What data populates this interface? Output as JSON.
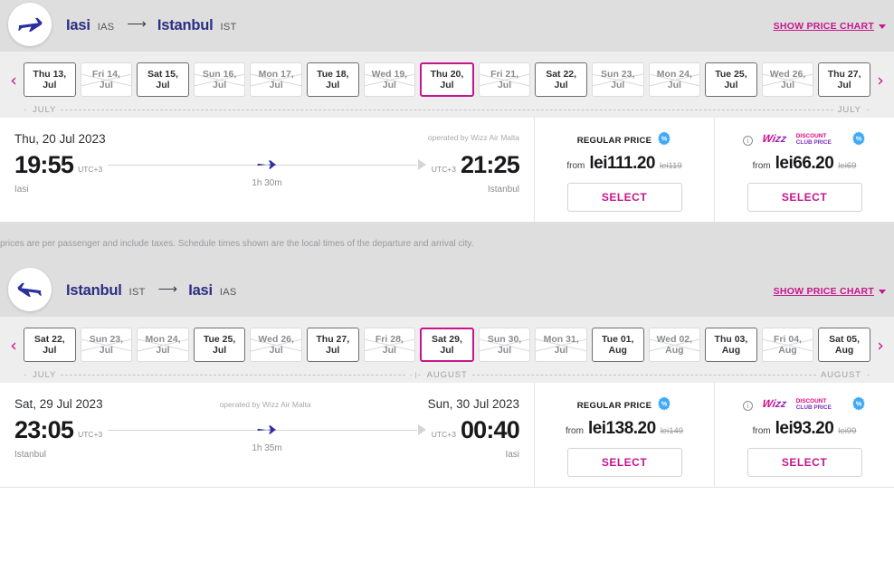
{
  "journeys": [
    {
      "icon": "plane-right-icon",
      "origin_city": "Iasi",
      "origin_code": "IAS",
      "arrow": "⟶",
      "dest_city": "Istanbul",
      "dest_code": "IST",
      "price_chart_label": "SHOW PRICE CHART",
      "dates": [
        {
          "day": "Thu 13,",
          "month": "Jul",
          "state": "avail"
        },
        {
          "day": "Fri 14,",
          "month": "Jul",
          "state": "unavail"
        },
        {
          "day": "Sat 15,",
          "month": "Jul",
          "state": "avail"
        },
        {
          "day": "Sun 16,",
          "month": "Jul",
          "state": "unavail"
        },
        {
          "day": "Mon 17,",
          "month": "Jul",
          "state": "unavail"
        },
        {
          "day": "Tue 18,",
          "month": "Jul",
          "state": "avail"
        },
        {
          "day": "Wed 19,",
          "month": "Jul",
          "state": "unavail"
        },
        {
          "day": "Thu 20,",
          "month": "Jul",
          "state": "selected"
        },
        {
          "day": "Fri 21,",
          "month": "Jul",
          "state": "unavail"
        },
        {
          "day": "Sat 22,",
          "month": "Jul",
          "state": "avail"
        },
        {
          "day": "Sun 23,",
          "month": "Jul",
          "state": "unavail"
        },
        {
          "day": "Mon 24,",
          "month": "Jul",
          "state": "unavail"
        },
        {
          "day": "Tue 25,",
          "month": "Jul",
          "state": "avail"
        },
        {
          "day": "Wed 26,",
          "month": "Jul",
          "state": "unavail"
        },
        {
          "day": "Thu 27,",
          "month": "Jul",
          "state": "avail"
        }
      ],
      "ruler": {
        "left_label": "JULY",
        "right_label": "JULY",
        "divider": false
      },
      "flight": {
        "depart_date": "Thu, 20 Jul 2023",
        "arrive_date": "",
        "operated_by": "operated by Wizz Air Malta",
        "depart_time": "19:55",
        "depart_utc": "UTC+3",
        "arrive_time": "21:25",
        "arrive_utc": "UTC+3",
        "duration": "1h 30m",
        "origin_city": "Iasi",
        "dest_city": "Istanbul"
      },
      "regular": {
        "label": "REGULAR PRICE",
        "from": "from",
        "amount": "lei111.20",
        "old": "lei119",
        "select": "SELECT"
      },
      "club": {
        "from": "from",
        "amount": "lei66.20",
        "old": "lei69",
        "select": "SELECT",
        "logo_word": "Wizz",
        "logo_line1": "DISCOUNT",
        "logo_line2": "CLUB PRICE"
      }
    },
    {
      "icon": "plane-left-icon",
      "origin_city": "Istanbul",
      "origin_code": "IST",
      "arrow": "⟶",
      "dest_city": "Iasi",
      "dest_code": "IAS",
      "price_chart_label": "SHOW PRICE CHART",
      "dates": [
        {
          "day": "Sat 22,",
          "month": "Jul",
          "state": "avail"
        },
        {
          "day": "Sun 23,",
          "month": "Jul",
          "state": "unavail"
        },
        {
          "day": "Mon 24,",
          "month": "Jul",
          "state": "unavail"
        },
        {
          "day": "Tue 25,",
          "month": "Jul",
          "state": "avail"
        },
        {
          "day": "Wed 26,",
          "month": "Jul",
          "state": "unavail"
        },
        {
          "day": "Thu 27,",
          "month": "Jul",
          "state": "avail"
        },
        {
          "day": "Fri 28,",
          "month": "Jul",
          "state": "unavail"
        },
        {
          "day": "Sat 29,",
          "month": "Jul",
          "state": "selected"
        },
        {
          "day": "Sun 30,",
          "month": "Jul",
          "state": "unavail"
        },
        {
          "day": "Mon 31,",
          "month": "Jul",
          "state": "unavail"
        },
        {
          "day": "Tue 01,",
          "month": "Aug",
          "state": "avail"
        },
        {
          "day": "Wed 02,",
          "month": "Aug",
          "state": "unavail"
        },
        {
          "day": "Thu 03,",
          "month": "Aug",
          "state": "avail"
        },
        {
          "day": "Fri 04,",
          "month": "Aug",
          "state": "unavail"
        },
        {
          "day": "Sat 05,",
          "month": "Aug",
          "state": "avail"
        }
      ],
      "ruler": {
        "left_label": "JULY",
        "mid_label": "AUGUST",
        "right_label": "AUGUST",
        "divider": true
      },
      "flight": {
        "depart_date": "Sat, 29 Jul 2023",
        "arrive_date": "Sun, 30 Jul 2023",
        "operated_by": "operated by Wizz Air Malta",
        "depart_time": "23:05",
        "depart_utc": "UTC+3",
        "arrive_time": "00:40",
        "arrive_utc": "UTC+3",
        "duration": "1h 35m",
        "origin_city": "Istanbul",
        "dest_city": "Iasi"
      },
      "regular": {
        "label": "REGULAR PRICE",
        "from": "from",
        "amount": "lei138.20",
        "old": "lei149",
        "select": "SELECT"
      },
      "club": {
        "from": "from",
        "amount": "lei93.20",
        "old": "lei99",
        "select": "SELECT",
        "logo_word": "Wizz",
        "logo_line1": "DISCOUNT",
        "logo_line2": "CLUB PRICE"
      }
    }
  ],
  "disclaimer": "prices are per passenger and include taxes. Schedule times shown are the local times of the departure and arrival city.",
  "nav": {
    "prev": "‹",
    "next": "›"
  },
  "colors": {
    "accent_pink": "#c6168d",
    "navy": "#2b2e83",
    "badge_blue": "#3fa9f5",
    "header_grey": "#dedede",
    "strip_grey": "#eeeeee"
  }
}
